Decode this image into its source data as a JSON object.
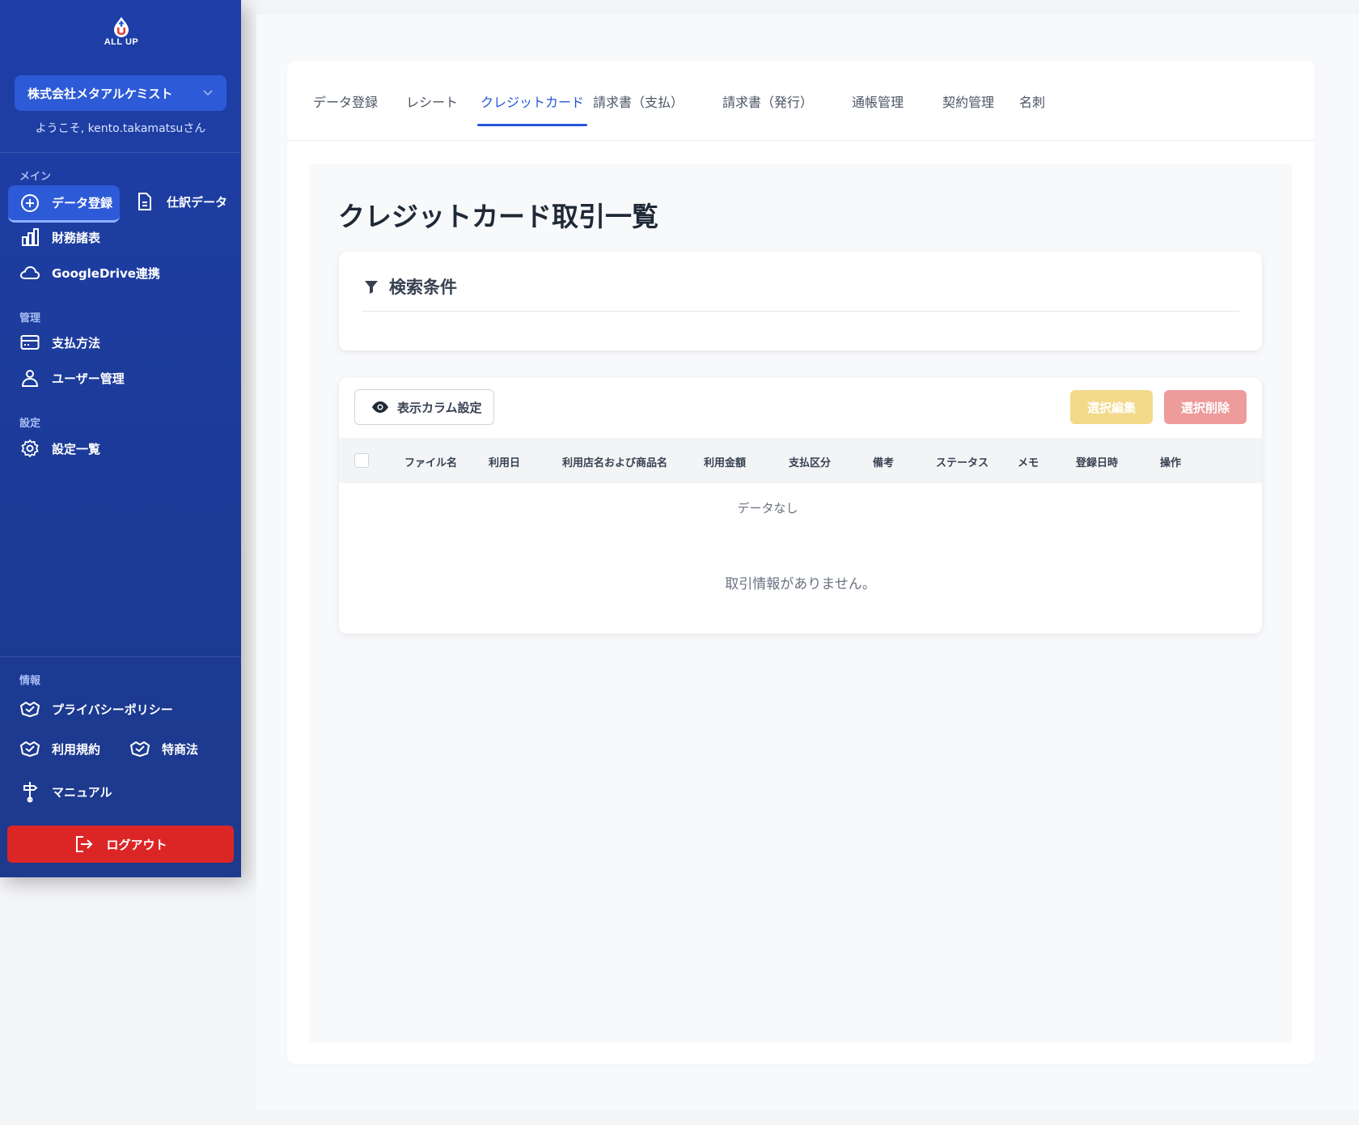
{
  "logo": {
    "text": "ALL UP"
  },
  "sidebar": {
    "company": "株式会社メタアルケミスト",
    "welcome": "ようこそ, kento.takamatsuさん",
    "sections": {
      "main": "メイン",
      "manage": "管理",
      "settings": "設定",
      "info": "情報"
    },
    "items": {
      "data_register": "データ登録",
      "journal_data": "仕訳データ",
      "financial": "財務諸表",
      "gdrive": "GoogleDrive連携",
      "payment": "支払方法",
      "users": "ユーザー管理",
      "settings_list": "設定一覧",
      "privacy": "プライバシーポリシー",
      "terms": "利用規約",
      "commerce": "特商法",
      "manual": "マニュアル"
    },
    "logout": "ログアウト"
  },
  "tabs": [
    {
      "label": "データ登録"
    },
    {
      "label": "レシート"
    },
    {
      "label": "クレジットカード"
    },
    {
      "label": "請求書（支払）"
    },
    {
      "label": "請求書（発行）"
    },
    {
      "label": "通帳管理"
    },
    {
      "label": "契約管理"
    },
    {
      "label": "名刺"
    }
  ],
  "page": {
    "title": "クレジットカード取引一覧",
    "search_title": "検索条件",
    "column_settings": "表示カラム設定",
    "bulk_edit": "選択編集",
    "bulk_delete": "選択削除",
    "columns": [
      "ファイル名",
      "利用日",
      "利用店名および商品名",
      "利用金額",
      "支払区分",
      "備考",
      "ステータス",
      "メモ",
      "登録日時",
      "操作"
    ],
    "no_data": "データなし",
    "empty_message": "取引情報がありません。"
  },
  "colors": {
    "sidebar": "#1e3fa8",
    "active_item": "#2d5ad6",
    "accent": "#2556d8",
    "logout": "#dc2626",
    "edit": "#f3d98a",
    "delete": "#ee9b9b"
  }
}
